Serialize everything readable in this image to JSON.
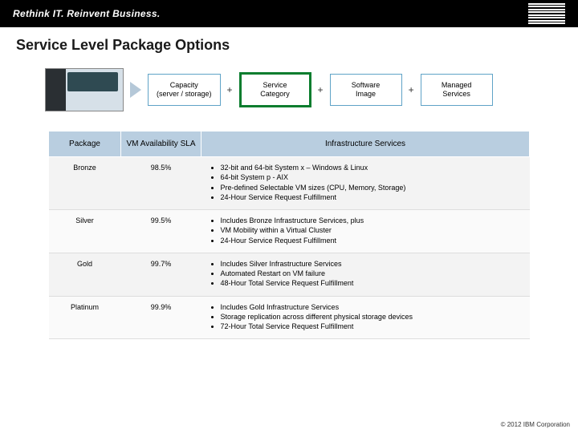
{
  "header": {
    "tagline": "Rethink IT. Reinvent Business.",
    "vendor": "IBM"
  },
  "title": "Service Level Package Options",
  "flow": {
    "box1_line1": "Capacity",
    "box1_line2": "(server / storage)",
    "box2_line1": "Service",
    "box2_line2": "Category",
    "box3_line1": "Software",
    "box3_line2": "Image",
    "box4_line1": "Managed",
    "box4_line2": "Services",
    "plus": "+"
  },
  "table": {
    "headers": {
      "package": "Package",
      "sla": "VM Availability SLA",
      "services": "Infrastructure Services"
    },
    "rows": [
      {
        "package": "Bronze",
        "sla": "98.5%",
        "items": [
          "32-bit and 64-bit  System x – Windows & Linux",
          "64-bit System p - AIX",
          "Pre-defined Selectable VM sizes (CPU, Memory, Storage)",
          "24-Hour Service Request Fulfillment"
        ]
      },
      {
        "package": "Silver",
        "sla": "99.5%",
        "items": [
          "Includes Bronze Infrastructure Services, plus",
          "VM Mobility within a Virtual Cluster",
          "24-Hour Service Request Fulfillment"
        ]
      },
      {
        "package": "Gold",
        "sla": "99.7%",
        "items": [
          "Includes Silver Infrastructure Services",
          "Automated Restart on VM failure",
          "48-Hour Total Service Request Fulfillment"
        ]
      },
      {
        "package": "Platinum",
        "sla": "99.9%",
        "items": [
          "Includes Gold Infrastructure Services",
          "Storage replication across different physical storage devices",
          "72-Hour Total Service Request Fulfillment"
        ]
      }
    ]
  },
  "footer": "© 2012 IBM Corporation"
}
